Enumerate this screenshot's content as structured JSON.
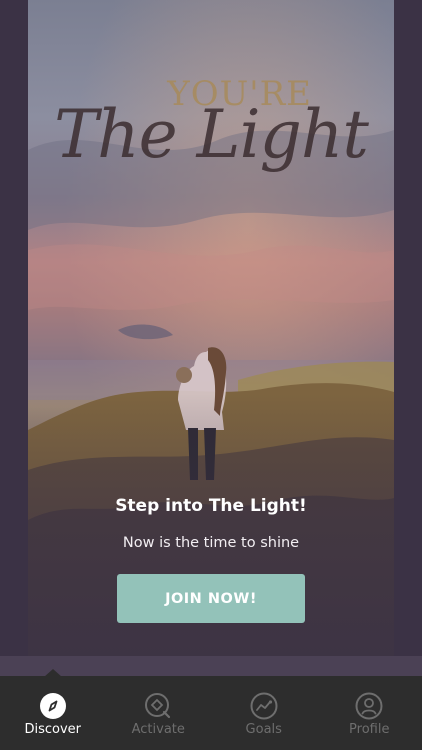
{
  "hero": {
    "title_top": "YOU'RE",
    "title_script": "The Light",
    "headline": "Step into The Light!",
    "subline": "Now is the time to shine",
    "cta_label": "JOIN NOW!"
  },
  "tabbar": {
    "tabs": [
      {
        "label": "Discover",
        "icon": "compass-icon",
        "active": true
      },
      {
        "label": "Activate",
        "icon": "target-icon",
        "active": false
      },
      {
        "label": "Goals",
        "icon": "trend-icon",
        "active": false
      },
      {
        "label": "Profile",
        "icon": "person-icon",
        "active": false
      }
    ]
  },
  "colors": {
    "background": "#3b3245",
    "accent_button": "#93c2b9",
    "tabbar": "#2d2d2d",
    "title_gold": "#a88a58"
  }
}
